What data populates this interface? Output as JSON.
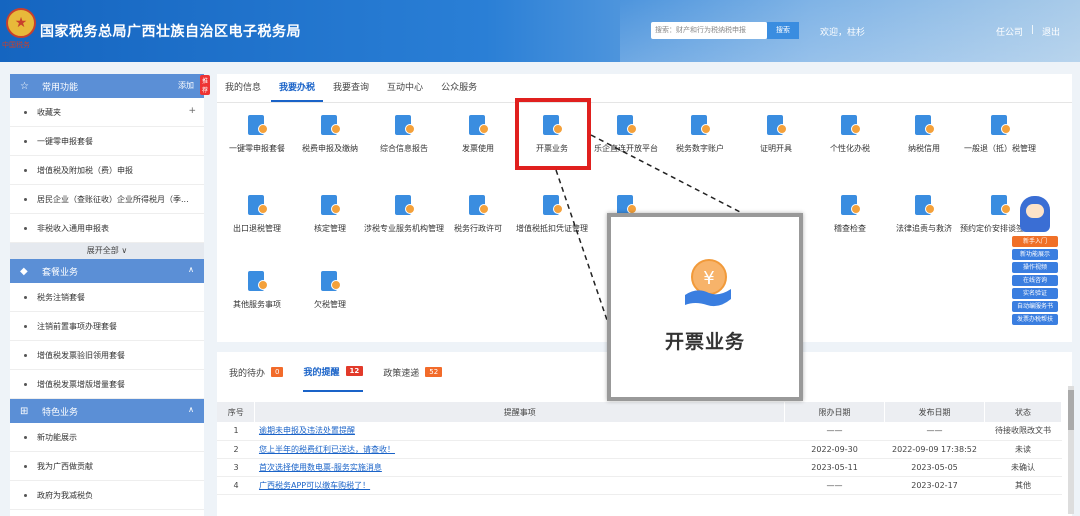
{
  "header": {
    "emblem_text": "中国税务",
    "title": "国家税务总局广西壮族自治区电子税务局",
    "search_placeholder": "搜索：财产和行为税纳税申报",
    "search_button": "搜索",
    "welcome": "欢迎，柱杉",
    "company": "任公司",
    "separator": "|",
    "logout": "退出"
  },
  "sidebar": {
    "common": {
      "title": "常用功能",
      "add": "添加",
      "badge": "推荐",
      "items": [
        "收藏夹",
        "一键零申报套餐",
        "增值税及附加税（费）申报",
        "居民企业（查账征收）企业所得税月（季...",
        "非税收入通用申报表"
      ],
      "plus": "+",
      "expand": "展开全部 ∨"
    },
    "package": {
      "title": "套餐业务",
      "toggle": "∧",
      "items": [
        "税务注销套餐",
        "注销前置事项办理套餐",
        "增值税发票验旧领用套餐",
        "增值税发票增版增量套餐"
      ]
    },
    "special": {
      "title": "特色业务",
      "toggle": "∧",
      "items": [
        "新功能展示",
        "我为广西做贡献",
        "政府为我减税负"
      ]
    }
  },
  "main": {
    "tabs": [
      "我的信息",
      "我要办税",
      "我要查询",
      "互动中心",
      "公众服务"
    ],
    "row1": [
      "一键零申报套餐",
      "税费申报及缴纳",
      "综合信息报告",
      "发票使用",
      "开票业务",
      "乐企直连开放平台",
      "税务数字账户",
      "证明开具",
      "个性化办税",
      "纳税信用",
      "一般退（抵）税管理"
    ],
    "row2": [
      "出口退税管理",
      "核定管理",
      "涉税专业服务机构管理",
      "税务行政许可",
      "增值税抵扣凭证管理",
      "税",
      "",
      "",
      "稽查检查",
      "法律追责与救济",
      "预约定价安排谈签申请"
    ],
    "row3": [
      "其他服务事项",
      "欠税管理"
    ],
    "zoom_label": "开票业务"
  },
  "bottom": {
    "tabs": [
      {
        "label": "我的待办",
        "count": "0"
      },
      {
        "label": "我的提醒",
        "count": "12"
      },
      {
        "label": "政策速递",
        "count": "52"
      }
    ],
    "table": {
      "headers": [
        "序号",
        "提醒事项",
        "限办日期",
        "发布日期",
        "状态"
      ],
      "rows": [
        [
          "1",
          "逾期未申报及违法处置提醒",
          "——",
          "——",
          "待接收限改文书"
        ],
        [
          "2",
          "您上半年的税费红利已送达，请查收！",
          "2022-09-30",
          "2022-09-09 17:38:52",
          "未读"
        ],
        [
          "3",
          "首次选择使用数电票-服务实施消息",
          "2023-05-11",
          "2023-05-05",
          "未确认"
        ],
        [
          "4",
          "广西税务APP可以缴车购税了！",
          "——",
          "2023-02-17",
          "其他"
        ]
      ]
    }
  },
  "float": {
    "buttons": [
      "新手入门",
      "新功能展示",
      "操作视频",
      "在线咨询",
      "实名验证",
      "自动编服务书",
      "发票办税帮扶"
    ]
  },
  "colors": {
    "header_blue": "#1565c0",
    "active_blue": "#1a63c8",
    "highlight_red": "#e0201e",
    "badge_orange": "#f26b2a"
  }
}
